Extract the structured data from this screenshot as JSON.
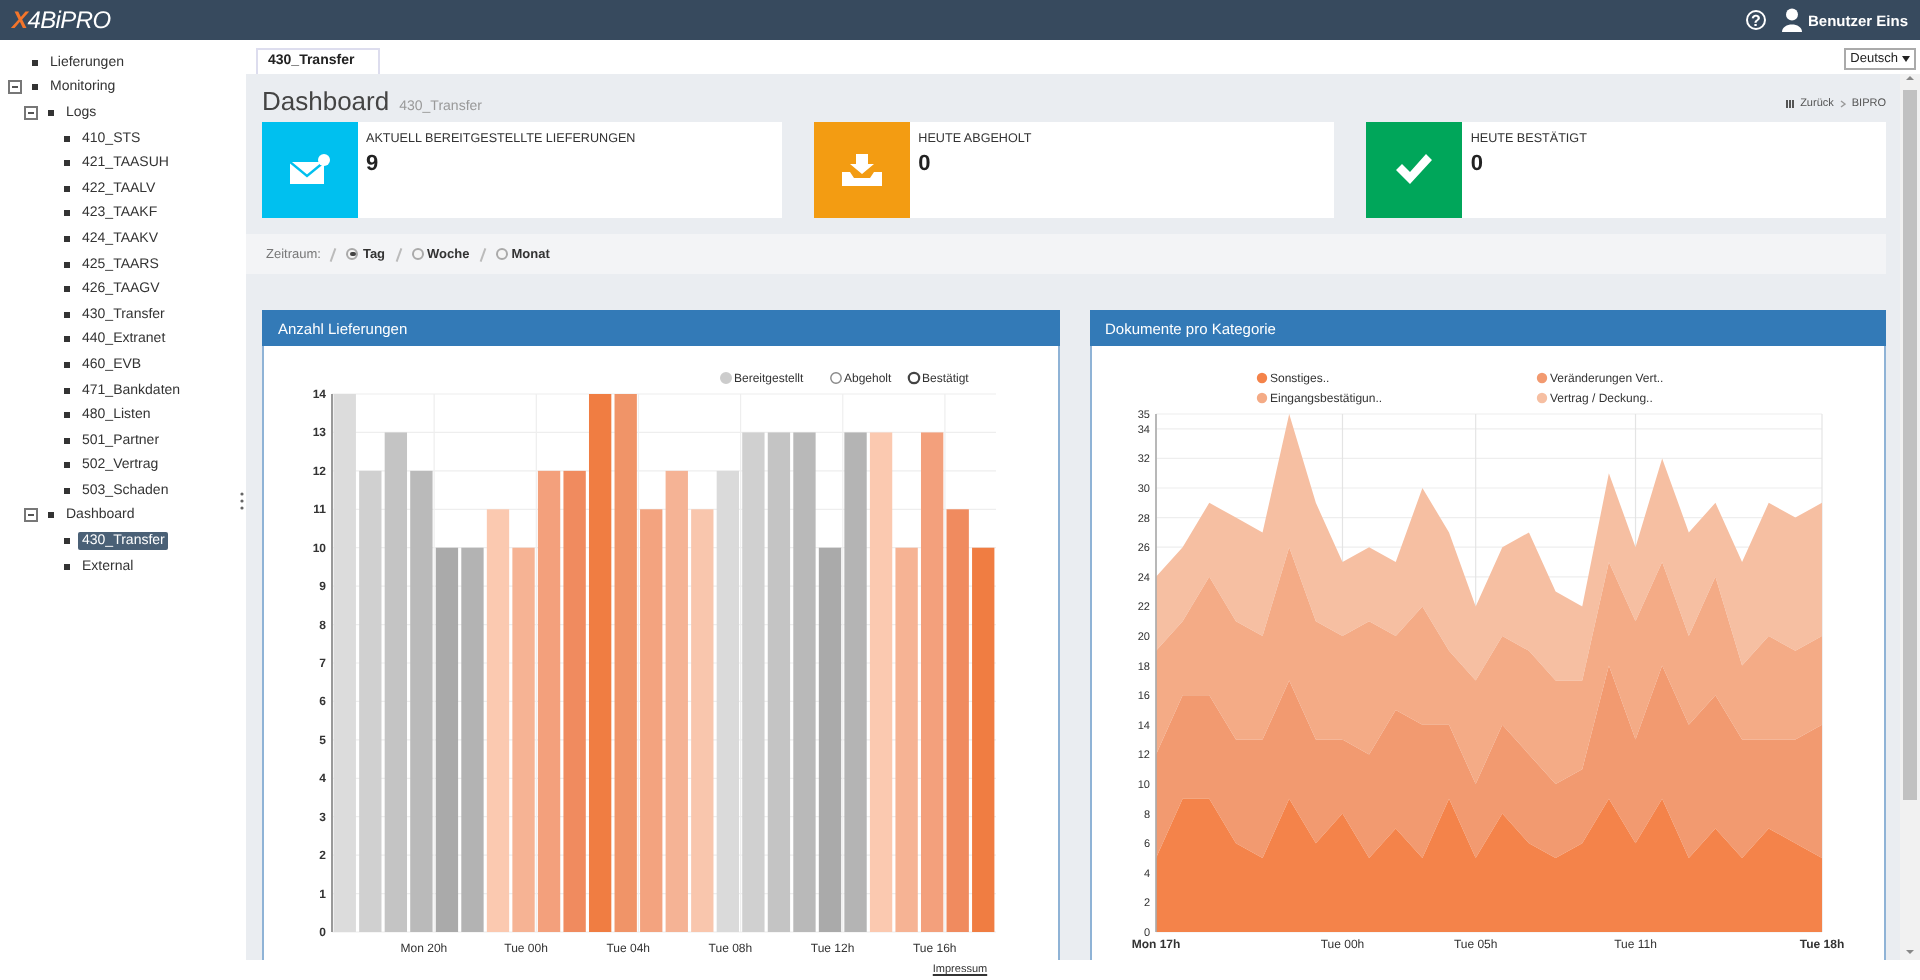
{
  "top_bar": {
    "logo": {
      "mark": "X",
      "text": "4BiPRO"
    },
    "help": "?",
    "user": "Benutzer Eins"
  },
  "sidebar": {
    "items": [
      {
        "label": "Lieferungen",
        "selected": false
      },
      {
        "label": "Monitoring",
        "selected": false,
        "expanded": true,
        "children": [
          {
            "label": "Logs",
            "selected": false,
            "expanded": true,
            "children": [
              {
                "label": "410_STS",
                "selected": false
              },
              {
                "label": "421_TAASUH",
                "selected": false
              },
              {
                "label": "422_TAALV",
                "selected": false
              },
              {
                "label": "423_TAAKF",
                "selected": false
              },
              {
                "label": "424_TAAKV",
                "selected": false
              },
              {
                "label": "425_TAARS",
                "selected": false
              },
              {
                "label": "426_TAAGV",
                "selected": false
              },
              {
                "label": "430_Transfer",
                "selected": false
              },
              {
                "label": "440_Extranet",
                "selected": false
              },
              {
                "label": "460_EVB",
                "selected": false
              },
              {
                "label": "471_Bankdaten",
                "selected": false
              },
              {
                "label": "480_Listen",
                "selected": false
              },
              {
                "label": "501_Partner",
                "selected": false
              },
              {
                "label": "502_Vertrag",
                "selected": false
              },
              {
                "label": "503_Schaden",
                "selected": false
              }
            ]
          },
          {
            "label": "Dashboard",
            "selected": false,
            "expanded": true,
            "children": [
              {
                "label": "430_Transfer",
                "selected": true
              },
              {
                "label": "External",
                "selected": false
              }
            ]
          }
        ]
      }
    ]
  },
  "tabs": [
    {
      "label": "430_Transfer",
      "selected": true
    }
  ],
  "language": "Deutsch",
  "page": {
    "title": "Dashboard",
    "subtitle": "430_Transfer",
    "breadcrumb": [
      "Zurück",
      "BIPRO"
    ]
  },
  "stats": [
    {
      "label": "AKTUELL BEREITGESTELLTE LIEFERUNGEN",
      "value": "9",
      "kind": "mail",
      "color": "#00c0ef"
    },
    {
      "label": "HEUTE ABGEHOLT",
      "value": "0",
      "kind": "download",
      "color": "#f39c12"
    },
    {
      "label": "HEUTE BESTÄTIGT",
      "value": "0",
      "kind": "check",
      "color": "#00a65a"
    }
  ],
  "filter": {
    "label": "Zeitraum:",
    "options": [
      {
        "label": "Tag",
        "selected": true
      },
      {
        "label": "Woche",
        "selected": false
      },
      {
        "label": "Monat",
        "selected": false
      }
    ]
  },
  "charts": [
    {
      "title": "Anzahl Lieferungen",
      "legend": [
        {
          "active": true
        },
        {
          "active": false
        },
        {
          "active": false
        }
      ],
      "chart_data": {
        "type": "bar",
        "legend": "top",
        "grid": true,
        "categories": [
          null,
          null,
          null,
          "Mon 20h",
          null,
          null,
          null,
          "Tue 00h",
          null,
          null,
          null,
          "Tue 04h",
          null,
          null,
          null,
          "Tue 08h",
          null,
          null,
          null,
          "Tue 12h",
          null,
          null,
          null,
          "Tue 16h",
          null,
          null
        ],
        "series": [
          {
            "name": "Bereitgestellt",
            "color": "#cccccc",
            "values": [
              14,
              12,
              13,
              12,
              10,
              10,
              11,
              10,
              12,
              12,
              14,
              14,
              11,
              12,
              11,
              12,
              13,
              13,
              13,
              10,
              13,
              13,
              10,
              13,
              11,
              10
            ],
            "colors": [
              "#dcdcdc",
              "#d0d0d0",
              "#c4c4c4",
              "#bababa",
              "#aaaaaa",
              "#b3b3b3",
              "#fbc9b0",
              "#f6b394",
              "#f3a07c",
              "#f08b5f",
              "#f07d42",
              "#f09468",
              "#f3a37f",
              "#f5b395",
              "#f9c6ad",
              "#dadada",
              "#d0d0d0",
              "#c4c4c4",
              "#b9b9b9",
              "#aaaaaa",
              "#b4b4b4",
              "#fbc9b0",
              "#f6b394",
              "#f3a07c",
              "#f08b5f",
              "#f07d42"
            ]
          },
          {
            "name": "Abgeholt",
            "color": "#888888",
            "values": [
              null,
              null,
              null,
              null,
              null,
              null,
              null,
              null,
              null,
              null,
              null,
              null,
              null,
              null,
              null,
              null,
              null,
              null,
              null,
              null,
              null,
              null,
              null,
              null,
              null,
              null
            ]
          },
          {
            "name": "Bestätigt",
            "color": "#444444",
            "values": [
              null,
              null,
              null,
              null,
              null,
              null,
              null,
              null,
              null,
              null,
              null,
              null,
              null,
              null,
              null,
              null,
              null,
              null,
              null,
              null,
              null,
              null,
              null,
              null,
              null,
              null
            ]
          }
        ],
        "ylim": [
          0,
          14
        ],
        "yticks": [
          0,
          1,
          2,
          3,
          4,
          5,
          6,
          7,
          8,
          9,
          10,
          11,
          12,
          13,
          14
        ]
      }
    },
    {
      "title": "Dokumente pro Kategorie",
      "chart_data": {
        "type": "area",
        "stacked": true,
        "legend": "top",
        "grid": true,
        "categories": [
          "Mon 17h",
          null,
          null,
          null,
          null,
          null,
          null,
          "Tue 00h",
          null,
          null,
          null,
          null,
          "Tue 05h",
          null,
          null,
          null,
          null,
          null,
          "Tue 11h",
          null,
          null,
          null,
          null,
          null,
          null,
          "Tue 18h"
        ],
        "series": [
          {
            "name": "Sonstiges..",
            "color": "#f4834a",
            "values": [
              5,
              9,
              9,
              6,
              5,
              9,
              6,
              8,
              5,
              7,
              5,
              9,
              5,
              8,
              6,
              5,
              6,
              9,
              6,
              9,
              5,
              7,
              5,
              7,
              6,
              5
            ]
          },
          {
            "name": "Veränderungen Vert..",
            "color": "#f29a70",
            "values": [
              7,
              7,
              7,
              7,
              8,
              8,
              7,
              5,
              7,
              8,
              9,
              5,
              5,
              6,
              6,
              5,
              5,
              9,
              7,
              9,
              9,
              9,
              8,
              6,
              7,
              9
            ]
          },
          {
            "name": "Eingangsbestätigun..",
            "color": "#f4ab86",
            "values": [
              7,
              5,
              8,
              8,
              7,
              9,
              8,
              7,
              9,
              5,
              8,
              5,
              7,
              6,
              7,
              7,
              6,
              7,
              8,
              7,
              6,
              8,
              5,
              7,
              6,
              6
            ]
          },
          {
            "name": "Vertrag / Deckung..",
            "color": "#f6bfa2",
            "values": [
              5,
              5,
              5,
              7,
              7,
              9,
              8,
              5,
              5,
              5,
              8,
              8,
              5,
              6,
              8,
              6,
              5,
              6,
              5,
              7,
              7,
              5,
              7,
              9,
              9,
              9
            ]
          }
        ],
        "ylim": [
          0,
          35
        ],
        "yticks": [
          0,
          2,
          4,
          6,
          8,
          10,
          12,
          14,
          16,
          18,
          20,
          22,
          24,
          26,
          28,
          30,
          32,
          34,
          35
        ]
      }
    }
  ],
  "footer": {
    "link": "Impressum"
  }
}
